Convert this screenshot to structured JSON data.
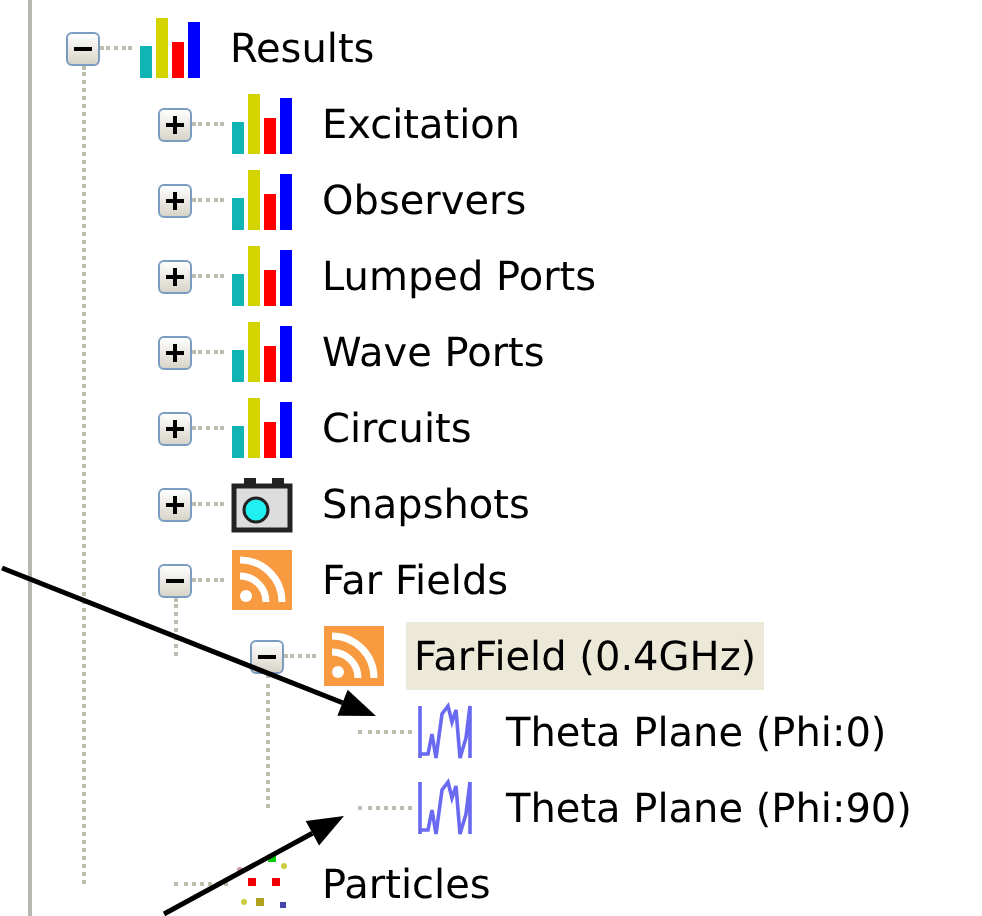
{
  "tree": [
    {
      "label": "Results",
      "kind": "chart",
      "expanded": true,
      "selected": false,
      "children": [
        {
          "label": "Excitation",
          "kind": "chart",
          "expanded": false,
          "selected": false
        },
        {
          "label": "Observers",
          "kind": "chart",
          "expanded": false,
          "selected": false
        },
        {
          "label": "Lumped Ports",
          "kind": "chart",
          "expanded": false,
          "selected": false
        },
        {
          "label": "Wave Ports",
          "kind": "chart",
          "expanded": false,
          "selected": false
        },
        {
          "label": "Circuits",
          "kind": "chart",
          "expanded": false,
          "selected": false
        },
        {
          "label": "Snapshots",
          "kind": "camera",
          "expanded": false,
          "selected": false
        },
        {
          "label": "Far Fields",
          "kind": "feed",
          "expanded": true,
          "selected": false,
          "children": [
            {
              "label": "FarField (0.4GHz)",
              "kind": "feed",
              "expanded": true,
              "selected": true,
              "children": [
                {
                  "label": "Theta Plane (Phi:0)",
                  "kind": "wave",
                  "selected": false
                },
                {
                  "label": "Theta Plane (Phi:90)",
                  "kind": "wave",
                  "selected": false
                }
              ]
            }
          ]
        },
        {
          "label": "Particles",
          "kind": "particles",
          "selected": false
        }
      ]
    }
  ],
  "annotations": [
    {
      "kind": "arrow"
    },
    {
      "kind": "arrow"
    }
  ]
}
